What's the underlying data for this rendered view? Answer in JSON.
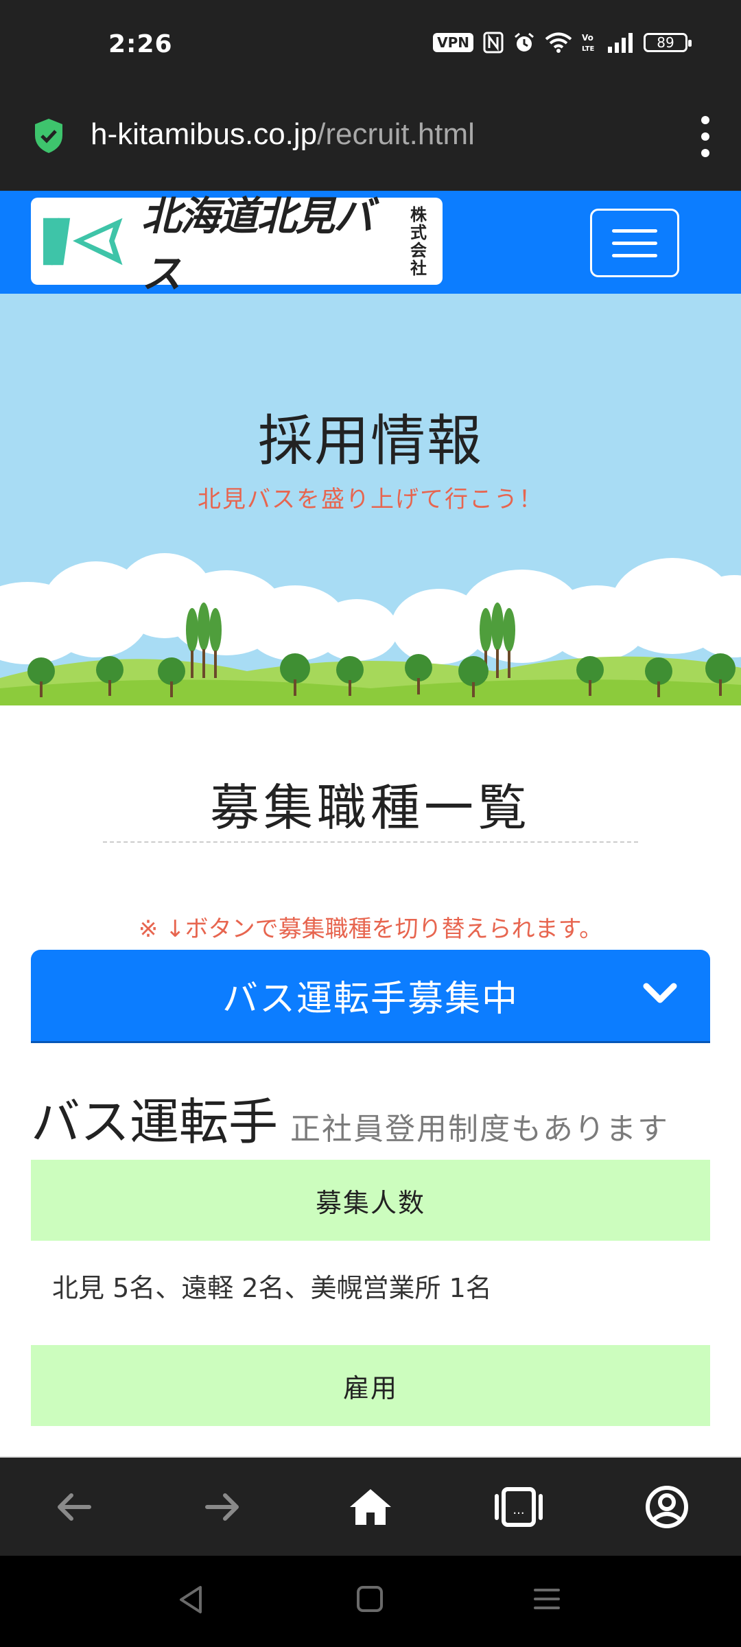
{
  "status_bar": {
    "time": "2:26",
    "vpn": "VPN",
    "battery": "89",
    "icons": [
      "vpn-icon",
      "nfc-icon",
      "alarm-icon",
      "wifi-icon",
      "volte-icon",
      "signal-icon",
      "battery-icon"
    ]
  },
  "browser": {
    "url_host": "h-kitamibus.co.jp",
    "url_path": "/recruit.html",
    "secure_color": "#3ec46d"
  },
  "header": {
    "logo_text": "北海道北見バス",
    "logo_kk_1": "株式",
    "logo_kk_2": "会社",
    "brand_color": "#0c7dff"
  },
  "hero": {
    "title": "採用情報",
    "subtitle": "北見バスを盛り上げて行こう！"
  },
  "main": {
    "section_title": "募集職種一覧",
    "note": "※ ↓ボタンで募集職種を切り替えられます。",
    "select_label": "バス運転手募集中",
    "job_title": "バス運転手",
    "job_note": "正社員登用制度もあります",
    "info": [
      {
        "label": "募集人数",
        "value": "北見 5名、遠軽 2名、美幌営業所 1名"
      },
      {
        "label": "雇用",
        "value": ""
      }
    ]
  },
  "toolbar": {
    "back": "back-arrow-icon",
    "forward": "forward-arrow-icon",
    "home": "home-icon",
    "tabs": "tabs-icon",
    "account": "account-icon"
  },
  "colors": {
    "accent_red": "#e7654f",
    "info_green": "#ccfdbe",
    "sky": "#a8dcf4"
  }
}
